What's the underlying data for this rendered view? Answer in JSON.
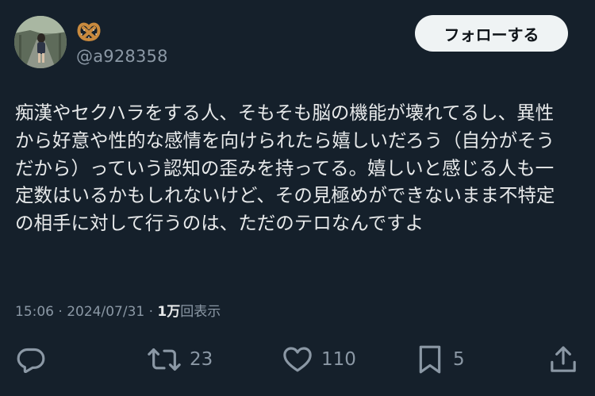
{
  "user": {
    "name_emoji": "🥨",
    "handle": "@a928358"
  },
  "follow_button": {
    "label": "フォローする"
  },
  "tweet": {
    "lines": [
      "痴漢やセクハラをする人、そもそも脳の機能が壊れてるし、異性",
      "から好意や性的な感情を向けられたら嬉しいだろう（自分がそう",
      "だから）っていう認知の歪みを持ってる。嬉しいと感じる人も一",
      "定数はいるかもしれないけど、その見極めができないまま不特定",
      "の相手に対して行うのは、ただのテロなんですよ"
    ]
  },
  "meta": {
    "time": "15:06",
    "separator": " · ",
    "date": "2024/07/31",
    "views_count": "1万",
    "views_label": "回表示"
  },
  "actions": {
    "reply": {
      "icon": "reply-icon",
      "count": ""
    },
    "retweet": {
      "icon": "retweet-icon",
      "count": "23"
    },
    "like": {
      "icon": "heart-icon",
      "count": "110"
    },
    "bookmark": {
      "icon": "bookmark-icon",
      "count": "5"
    },
    "share": {
      "icon": "share-icon"
    }
  },
  "colors": {
    "background": "#15202b",
    "text": "#e7e9ea",
    "muted": "#8b98a5",
    "button_bg": "#eff3f4",
    "button_text": "#0f1419"
  }
}
